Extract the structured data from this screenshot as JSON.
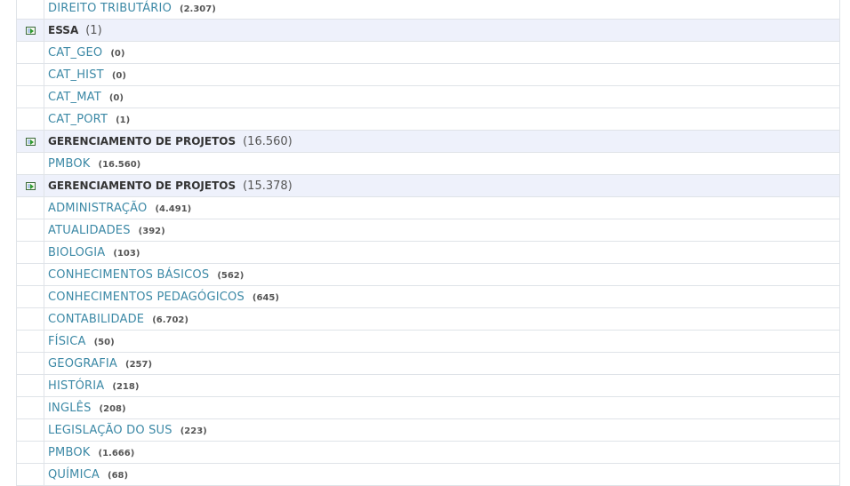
{
  "rows": [
    {
      "type": "item",
      "label": "DIREITO TRIBUTÁRIO",
      "count": "(2.307)"
    },
    {
      "type": "group",
      "label": "ESSA",
      "count": "(1)"
    },
    {
      "type": "item",
      "label": "CAT_GEO",
      "count": "(0)"
    },
    {
      "type": "item",
      "label": "CAT_HIST",
      "count": "(0)"
    },
    {
      "type": "item",
      "label": "CAT_MAT",
      "count": "(0)"
    },
    {
      "type": "item",
      "label": "CAT_PORT",
      "count": "(1)"
    },
    {
      "type": "group",
      "label": "GERENCIAMENTO DE PROJETOS",
      "count": "(16.560)"
    },
    {
      "type": "item",
      "label": "PMBOK",
      "count": "(16.560)"
    },
    {
      "type": "group",
      "label": "GERENCIAMENTO DE PROJETOS",
      "count": "(15.378)"
    },
    {
      "type": "item",
      "label": "ADMINISTRAÇÃO",
      "count": "(4.491)"
    },
    {
      "type": "item",
      "label": "ATUALIDADES",
      "count": "(392)"
    },
    {
      "type": "item",
      "label": "BIOLOGIA",
      "count": "(103)"
    },
    {
      "type": "item",
      "label": "CONHECIMENTOS BÁSICOS",
      "count": "(562)"
    },
    {
      "type": "item",
      "label": "CONHECIMENTOS PEDAGÓGICOS",
      "count": "(645)"
    },
    {
      "type": "item",
      "label": "CONTABILIDADE",
      "count": "(6.702)"
    },
    {
      "type": "item",
      "label": "FÍSICA",
      "count": "(50)"
    },
    {
      "type": "item",
      "label": "GEOGRAFIA",
      "count": "(257)"
    },
    {
      "type": "item",
      "label": "HISTÓRIA",
      "count": "(218)"
    },
    {
      "type": "item",
      "label": "INGLÊS",
      "count": "(208)"
    },
    {
      "type": "item",
      "label": "LEGISLAÇÃO DO SUS",
      "count": "(223)"
    },
    {
      "type": "item",
      "label": "PMBOK",
      "count": "(1.666)"
    },
    {
      "type": "item",
      "label": "QUÍMICA",
      "count": "(68)"
    }
  ],
  "icons": {
    "group_icon": "expand-group-icon"
  },
  "colors": {
    "link": "#3c89a6",
    "group_bg": "#eef1fb",
    "border": "#dfe3e8"
  }
}
